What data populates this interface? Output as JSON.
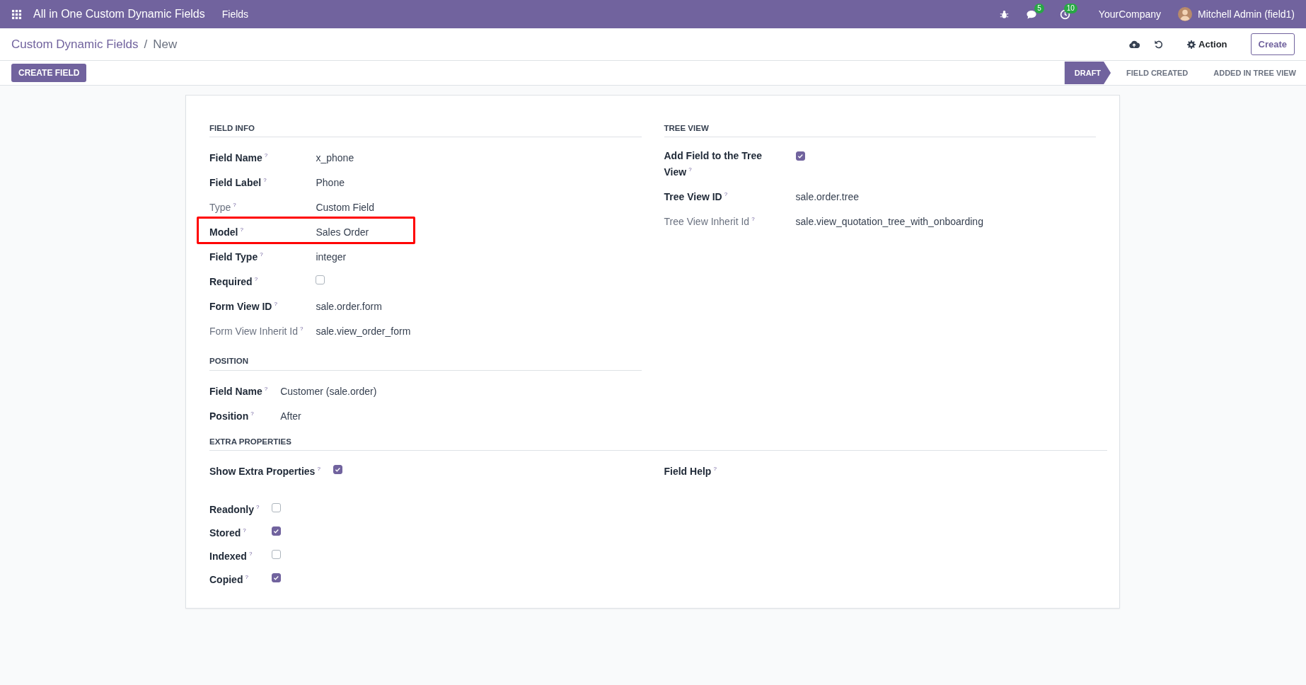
{
  "navbar": {
    "app_title": "All in One Custom Dynamic Fields",
    "menu": [
      "Fields"
    ],
    "messages_count": "5",
    "activities_count": "10",
    "company": "YourCompany",
    "user": "Mitchell Admin (field1)"
  },
  "breadcrumb": {
    "parent": "Custom Dynamic Fields",
    "separator": "/",
    "current": "New"
  },
  "toolbar": {
    "action": "Action",
    "create": "Create"
  },
  "create_field_button": "CREATE FIELD",
  "stages": [
    {
      "label": "DRAFT",
      "selected": true
    },
    {
      "label": "FIELD CREATED",
      "selected": false
    },
    {
      "label": "ADDED IN TREE VIEW",
      "selected": false
    }
  ],
  "left_sections": [
    {
      "title": "FIELD INFO",
      "fields": [
        {
          "kind": "text",
          "label": "Field Name",
          "help": "?",
          "value": "x_phone",
          "readonly": false,
          "highlighted": false
        },
        {
          "kind": "text",
          "label": "Field Label",
          "help": "?",
          "value": "Phone",
          "readonly": false,
          "highlighted": false
        },
        {
          "kind": "text",
          "label": "Type",
          "help": "?",
          "value": "Custom Field",
          "readonly": true,
          "highlighted": false
        },
        {
          "kind": "text",
          "label": "Model",
          "help": "?",
          "value": "Sales Order",
          "readonly": false,
          "highlighted": true
        },
        {
          "kind": "text",
          "label": "Field Type",
          "help": "?",
          "value": "integer",
          "readonly": false,
          "highlighted": false
        },
        {
          "kind": "checkbox",
          "label": "Required",
          "help": "?",
          "checked": false,
          "readonly": false,
          "highlighted": false
        },
        {
          "kind": "text",
          "label": "Form View ID",
          "help": "?",
          "value": "sale.order.form",
          "readonly": false,
          "highlighted": false
        },
        {
          "kind": "text",
          "label": "Form View Inherit Id",
          "help": "?",
          "value": "sale.view_order_form",
          "readonly": true,
          "highlighted": false
        }
      ]
    },
    {
      "title": "POSITION",
      "fields": [
        {
          "kind": "text",
          "label": "Field Name",
          "help": "?",
          "value": "Customer (sale.order)",
          "readonly": false,
          "highlighted": false
        },
        {
          "kind": "text",
          "label": "Position",
          "help": "?",
          "value": "After",
          "readonly": false,
          "highlighted": false
        }
      ]
    }
  ],
  "right_sections": [
    {
      "title": "TREE VIEW",
      "fields": [
        {
          "kind": "checkbox",
          "label": "Add Field to the Tree View",
          "help": "?",
          "checked": true,
          "readonly": false,
          "highlighted": false
        },
        {
          "kind": "text",
          "label": "Tree View ID",
          "help": "?",
          "value": "sale.order.tree",
          "readonly": false,
          "highlighted": false
        },
        {
          "kind": "text",
          "label": "Tree View Inherit Id",
          "help": "?",
          "value": "sale.view_quotation_tree_with_onboarding",
          "readonly": true,
          "highlighted": false
        }
      ]
    }
  ],
  "extra": {
    "title": "EXTRA PROPERTIES",
    "left_fields": [
      {
        "kind": "checkbox",
        "label": "Show Extra Properties",
        "help": "?",
        "checked": true,
        "readonly": false,
        "highlighted": false
      }
    ],
    "options": [
      {
        "kind": "checkbox",
        "label": "Readonly",
        "help": "?",
        "checked": false,
        "readonly": false,
        "highlighted": false
      },
      {
        "kind": "checkbox",
        "label": "Stored",
        "help": "?",
        "checked": true,
        "readonly": false,
        "highlighted": false
      },
      {
        "kind": "checkbox",
        "label": "Indexed",
        "help": "?",
        "checked": false,
        "readonly": false,
        "highlighted": false
      },
      {
        "kind": "checkbox",
        "label": "Copied",
        "help": "?",
        "checked": true,
        "readonly": false,
        "highlighted": false
      }
    ],
    "right_fields": [
      {
        "label": "Field Help",
        "help": "?",
        "readonly": false,
        "highlighted": false
      }
    ]
  }
}
